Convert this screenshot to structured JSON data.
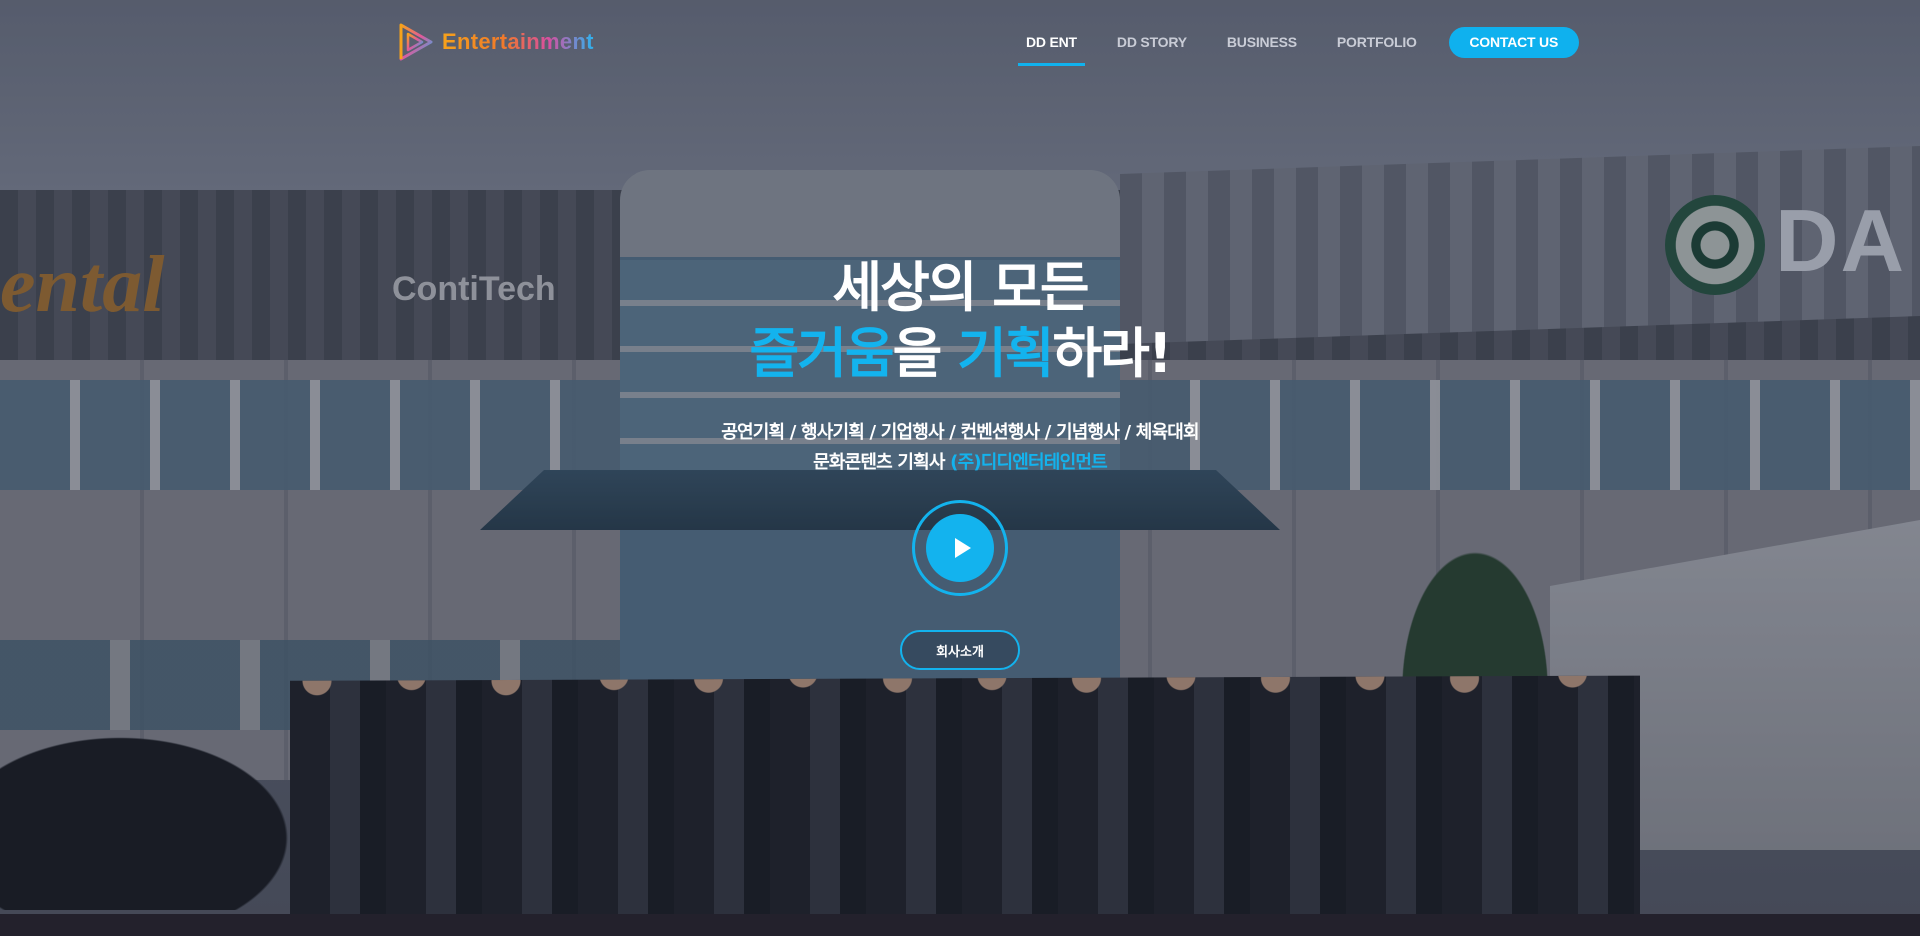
{
  "brand": {
    "name": "Entertainment"
  },
  "nav": {
    "items": [
      {
        "label": "DD ENT",
        "active": true
      },
      {
        "label": "DD STORY",
        "active": false
      },
      {
        "label": "BUSINESS",
        "active": false
      },
      {
        "label": "PORTFOLIO",
        "active": false
      }
    ],
    "contact_label": "CONTACT US"
  },
  "hero": {
    "title_line1": "세상의 모든",
    "title_line2": {
      "accent1": "즐거움",
      "mid1": "을 ",
      "accent2": "기획",
      "tail": "하라!"
    },
    "subtitle_line1": "공연기획 / 행사기획 / 기업행사 / 컨벤션행사 / 기념행사 / 체육대회",
    "subtitle_line2": {
      "text": "문화콘텐츠 기획사 ",
      "accent": "(주)디디엔터테인먼트"
    },
    "about_button": "회사소개"
  },
  "background": {
    "sign_left": "ental",
    "sign_center": "ContiTech",
    "sign_right": "DA"
  },
  "colors": {
    "accent": "#13b3ee",
    "nav_active_underline": "#10b2ee",
    "contact_button": "#0fb1ee"
  },
  "icons": {
    "play": "play-icon",
    "logo": "logo-play-mark-icon"
  }
}
